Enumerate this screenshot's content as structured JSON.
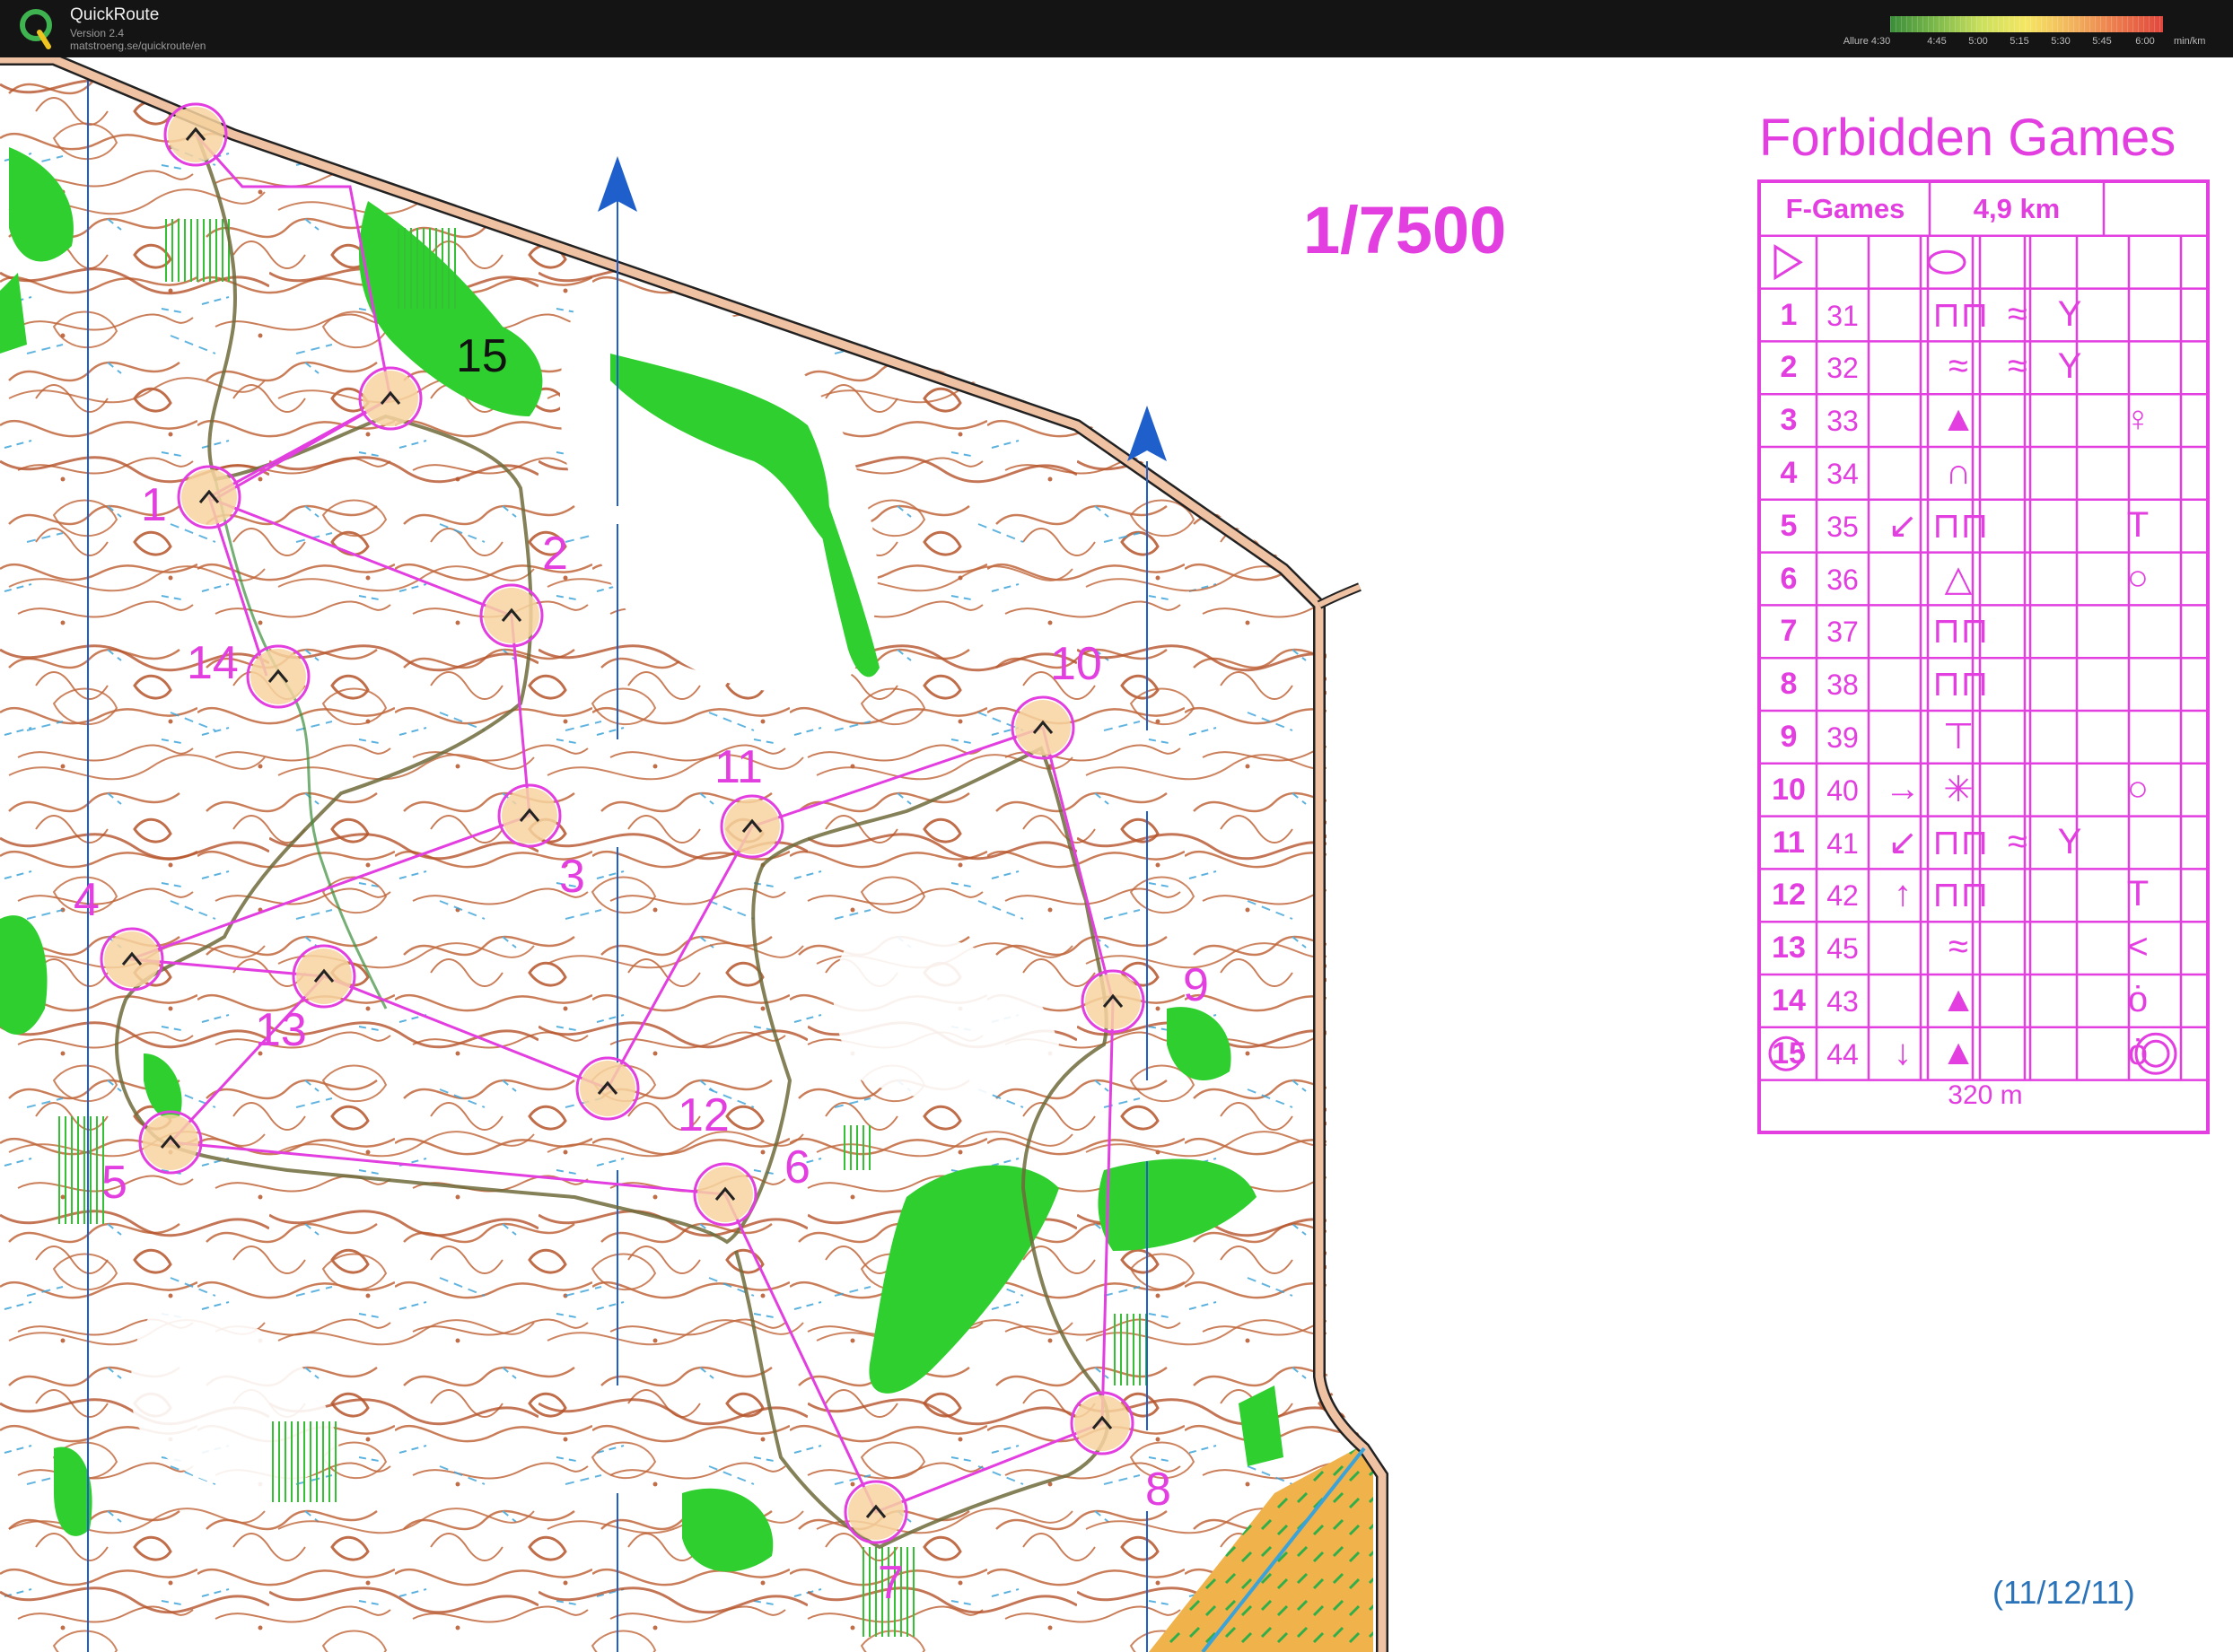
{
  "app": {
    "name": "QuickRoute",
    "version": "Version 2.4",
    "url": "matstroeng.se/quickroute/en"
  },
  "pace_legend": {
    "labels": [
      "Allure 4:30",
      "4:45",
      "5:00",
      "5:15",
      "5:30",
      "5:45",
      "6:00"
    ],
    "unit": "min/km",
    "colors": [
      "#3b8d3a",
      "#7cb94a",
      "#cbe05e",
      "#f5e663",
      "#f2b45d",
      "#ec7a4d",
      "#e0473d"
    ]
  },
  "map": {
    "title": "Forbidden Games",
    "scale": "1/7500",
    "date": "(11/12/11)",
    "colors": {
      "course": "#e23ee0",
      "contour": "#b5532a",
      "vegetation": "#2fcf2f",
      "water": "#3ca3d8",
      "road": "#f0c2a4",
      "north_lines": "#1f5fcc",
      "route": "#6f6a3a",
      "sand": "#f0b24a"
    },
    "control_labels": [
      {
        "text": "1"
      },
      {
        "text": "2"
      },
      {
        "text": "3"
      },
      {
        "text": "4"
      },
      {
        "text": "5"
      },
      {
        "text": "6"
      },
      {
        "text": "7"
      },
      {
        "text": "8"
      },
      {
        "text": "9"
      },
      {
        "text": "10"
      },
      {
        "text": "11"
      },
      {
        "text": "12"
      },
      {
        "text": "13"
      },
      {
        "text": "14"
      },
      {
        "text": "15"
      }
    ]
  },
  "control_descriptions": {
    "course": "F-Games",
    "length": "4,9 km",
    "finish_distance": "320 m",
    "rows": [
      {
        "num": "1",
        "code": "31"
      },
      {
        "num": "2",
        "code": "32"
      },
      {
        "num": "3",
        "code": "33"
      },
      {
        "num": "4",
        "code": "34"
      },
      {
        "num": "5",
        "code": "35"
      },
      {
        "num": "6",
        "code": "36"
      },
      {
        "num": "7",
        "code": "37"
      },
      {
        "num": "8",
        "code": "38"
      },
      {
        "num": "9",
        "code": "39"
      },
      {
        "num": "10",
        "code": "40"
      },
      {
        "num": "11",
        "code": "41"
      },
      {
        "num": "12",
        "code": "42"
      },
      {
        "num": "13",
        "code": "45"
      },
      {
        "num": "14",
        "code": "43"
      },
      {
        "num": "15",
        "code": "44"
      }
    ]
  }
}
